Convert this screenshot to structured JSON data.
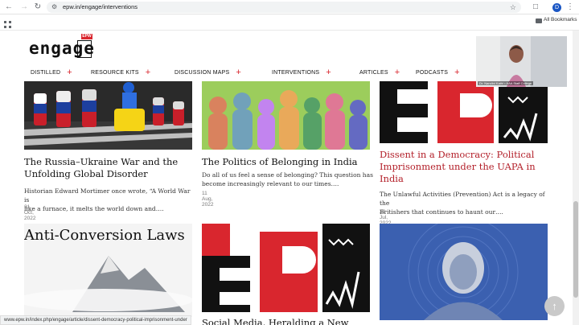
{
  "browser": {
    "url": "epw.in/engage/interventions",
    "bookmarks_label": "All Bookmarks",
    "profile_initial": "D",
    "status_url": "www.epw.in/index.php/engage/article/dissent-democracy-political-imprisonment-under"
  },
  "site": {
    "logo_text": "engage",
    "logo_badge": "EPW"
  },
  "nav": {
    "items": [
      {
        "label": "DISTILLED",
        "plus": "+"
      },
      {
        "label": "RESOURCE KITS",
        "plus": "+"
      },
      {
        "label": "DISCUSSION MAPS",
        "plus": "+"
      },
      {
        "label": "INTERVENTIONS",
        "plus": "+"
      },
      {
        "label": "ARTICLES",
        "plus": "+"
      },
      {
        "label": "PODCASTS",
        "plus": "+"
      }
    ]
  },
  "cards": [
    {
      "title_line1": "The Russia–Ukraine War and the",
      "title_line2": "Unfolding Global Disorder",
      "excerpt_line1": "Historian Edward Mortimer once wrote, “A World War is",
      "excerpt_line2": "like a furnace, it melts the world down and….",
      "date": "31 Oct, 2022"
    },
    {
      "title_line1": "The Politics of Belonging in India",
      "excerpt_line1": "Do all of us feel a sense of belonging? This question has",
      "excerpt_line2": "become increasingly relevant to our times….",
      "date": "11 Aug, 2022"
    },
    {
      "title_line1": "Dissent in a Democracy: Political",
      "title_line2": "Imprisonment under the UAPA in",
      "title_line3": "India",
      "excerpt_line1": "The Unlawful Activities (Prevention) Act is a legacy of the",
      "excerpt_line2": "Britishers that continues to haunt our….",
      "date": "29 Jul, 2022"
    },
    {
      "thumb_text": "Anti-Conversion Laws"
    },
    {
      "title_partial": "Social Media, Heralding a New World"
    },
    {}
  ],
  "video": {
    "caption": "Dr. Nandini Kathi • AAA Staff College"
  },
  "colors": {
    "accent_red": "#d9262e",
    "title_red": "#b3202a",
    "chess_bg": "#2b2b2b",
    "politics_green": "#8cc44c",
    "blue_portrait": "#3a5fae"
  },
  "icons": [
    "back-arrow-icon",
    "forward-arrow-icon",
    "reload-icon",
    "apps-grid-icon",
    "site-settings-icon",
    "bookmark-star-icon",
    "extensions-icon",
    "folder-icon",
    "scroll-to-top-icon"
  ]
}
